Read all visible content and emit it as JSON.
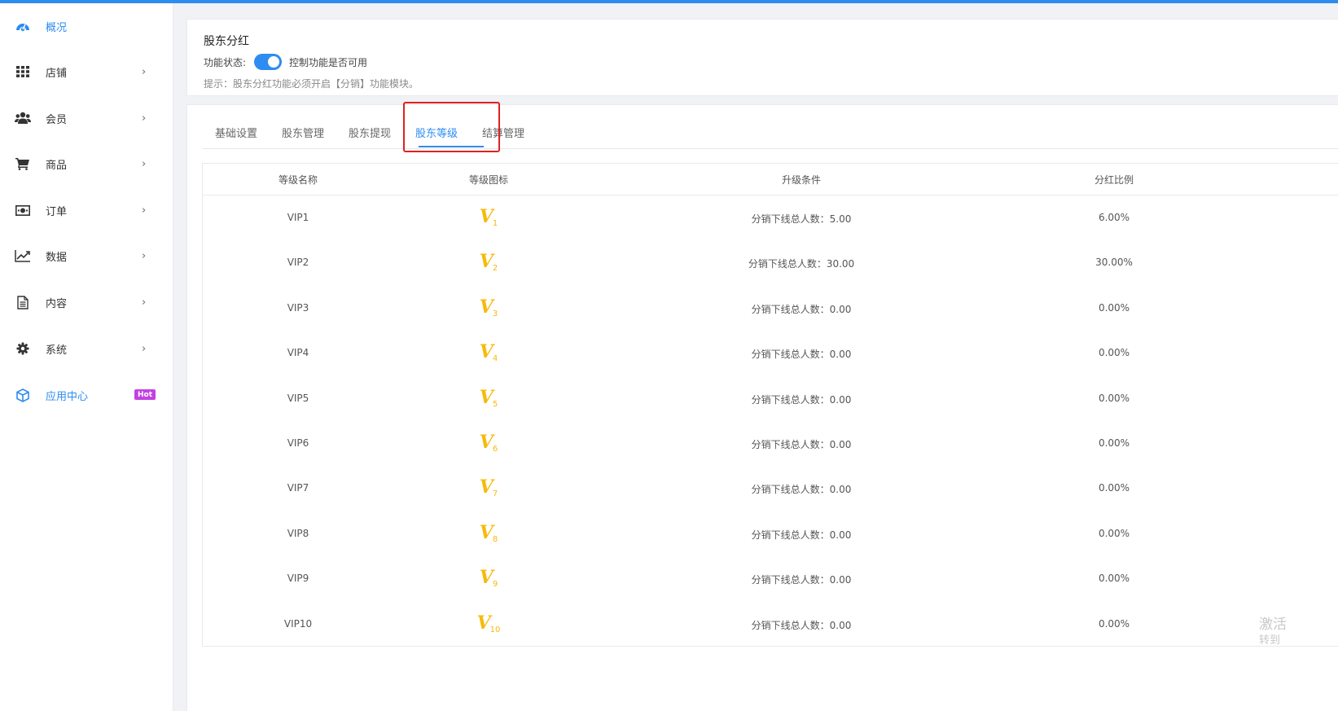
{
  "sidebar": {
    "items": [
      {
        "label": "概况",
        "icon": "dashboard-icon",
        "active": true,
        "chevron": ""
      },
      {
        "label": "店铺",
        "icon": "grid-icon",
        "chevron": "›"
      },
      {
        "label": "会员",
        "icon": "users-icon",
        "chevron": "›"
      },
      {
        "label": "商品",
        "icon": "cart-icon",
        "chevron": "›"
      },
      {
        "label": "订单",
        "icon": "money-icon",
        "chevron": "›"
      },
      {
        "label": "数据",
        "icon": "chart-icon",
        "chevron": "›"
      },
      {
        "label": "内容",
        "icon": "document-icon",
        "chevron": "›"
      },
      {
        "label": "系统",
        "icon": "gear-icon",
        "chevron": "›"
      },
      {
        "label": "应用中心",
        "icon": "cube-icon",
        "active": true,
        "badge": "Hot"
      }
    ]
  },
  "header": {
    "title": "股东分红",
    "status_label": "功能状态:",
    "toggle_on": true,
    "toggle_desc": "控制功能是否可用",
    "tip": "提示：股东分红功能必须开启【分销】功能模块。"
  },
  "tabs": [
    {
      "label": "基础设置"
    },
    {
      "label": "股东管理"
    },
    {
      "label": "股东提现"
    },
    {
      "label": "股东等级",
      "active": true
    },
    {
      "label": "结算管理"
    }
  ],
  "table": {
    "headers": [
      "等级名称",
      "等级图标",
      "升级条件",
      "分红比例"
    ],
    "rows": [
      {
        "name": "VIP1",
        "icon_num": "1",
        "condition": "分销下线总人数：5.00",
        "ratio": "6.00%"
      },
      {
        "name": "VIP2",
        "icon_num": "2",
        "condition": "分销下线总人数：30.00",
        "ratio": "30.00%"
      },
      {
        "name": "VIP3",
        "icon_num": "3",
        "condition": "分销下线总人数：0.00",
        "ratio": "0.00%"
      },
      {
        "name": "VIP4",
        "icon_num": "4",
        "condition": "分销下线总人数：0.00",
        "ratio": "0.00%"
      },
      {
        "name": "VIP5",
        "icon_num": "5",
        "condition": "分销下线总人数：0.00",
        "ratio": "0.00%"
      },
      {
        "name": "VIP6",
        "icon_num": "6",
        "condition": "分销下线总人数：0.00",
        "ratio": "0.00%"
      },
      {
        "name": "VIP7",
        "icon_num": "7",
        "condition": "分销下线总人数：0.00",
        "ratio": "0.00%"
      },
      {
        "name": "VIP8",
        "icon_num": "8",
        "condition": "分销下线总人数：0.00",
        "ratio": "0.00%"
      },
      {
        "name": "VIP9",
        "icon_num": "9",
        "condition": "分销下线总人数：0.00",
        "ratio": "0.00%"
      },
      {
        "name": "VIP10",
        "icon_num": "10",
        "condition": "分销下线总人数：0.00",
        "ratio": "0.00%"
      }
    ]
  },
  "watermark": {
    "line1": "激活",
    "line2": "转到"
  },
  "colors": {
    "accent": "#2d8cf0",
    "vip_icon": "#f7ba0b",
    "hot_badge": "#c341e3",
    "highlight": "#e02020"
  }
}
